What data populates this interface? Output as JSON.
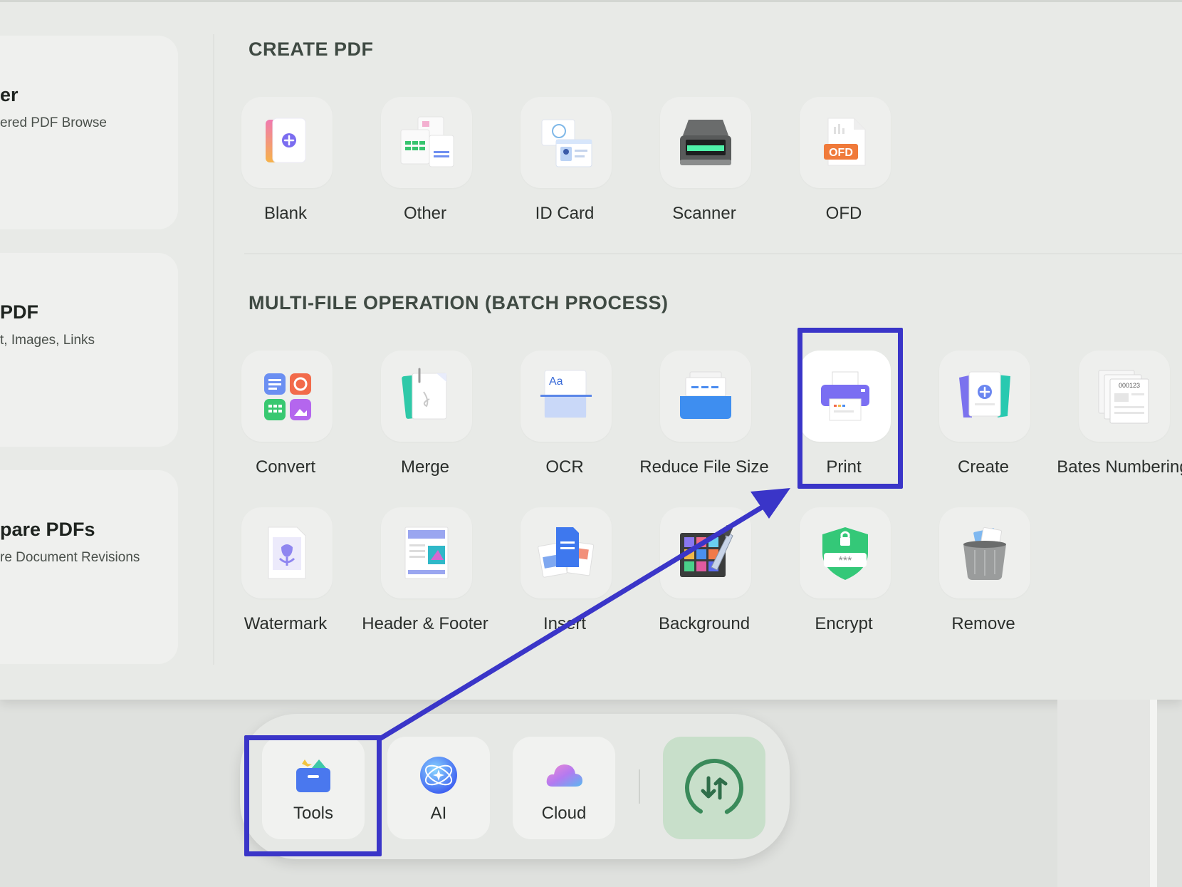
{
  "left_cards": [
    {
      "title": "er",
      "subtitle": "ered PDF Browse"
    },
    {
      "title": "PDF",
      "subtitle": "t, Images, Links"
    },
    {
      "title": "pare PDFs",
      "subtitle": "re Document Revisions"
    }
  ],
  "sections": {
    "create_pdf": {
      "title": "CREATE PDF",
      "items": [
        {
          "label": "Blank",
          "icon": "blank-page-icon"
        },
        {
          "label": "Other",
          "icon": "other-files-icon"
        },
        {
          "label": "ID Card",
          "icon": "id-card-icon"
        },
        {
          "label": "Scanner",
          "icon": "scanner-icon"
        },
        {
          "label": "OFD",
          "icon": "ofd-file-icon",
          "badge": "OFD"
        }
      ]
    },
    "batch": {
      "title": "MULTI-FILE OPERATION (BATCH PROCESS)",
      "items": [
        {
          "label": "Convert",
          "icon": "convert-icon"
        },
        {
          "label": "Merge",
          "icon": "merge-icon"
        },
        {
          "label": "OCR",
          "icon": "ocr-icon",
          "badge": "Aa"
        },
        {
          "label": "Reduce File Size",
          "icon": "compress-tray-icon"
        },
        {
          "label": "Print",
          "icon": "printer-icon",
          "highlighted": true
        },
        {
          "label": "Create",
          "icon": "create-pdf-icon"
        },
        {
          "label": "Bates Numbering",
          "icon": "bates-numbering-icon",
          "badge": "000123"
        },
        {
          "label": "Watermark",
          "icon": "watermark-icon"
        },
        {
          "label": "Header & Footer",
          "icon": "header-footer-icon"
        },
        {
          "label": "Insert",
          "icon": "insert-pages-icon"
        },
        {
          "label": "Background",
          "icon": "background-palette-icon"
        },
        {
          "label": "Encrypt",
          "icon": "shield-lock-icon",
          "badge": "***"
        },
        {
          "label": "Remove",
          "icon": "trash-bin-icon"
        }
      ]
    }
  },
  "dock": {
    "items": [
      {
        "label": "Tools",
        "icon": "toolbox-icon",
        "highlighted": true
      },
      {
        "label": "AI",
        "icon": "ai-sparkle-icon"
      },
      {
        "label": "Cloud",
        "icon": "cloud-icon"
      }
    ],
    "sync_icon": "sync-icon"
  },
  "annotation": {
    "color": "#3a35c8"
  }
}
